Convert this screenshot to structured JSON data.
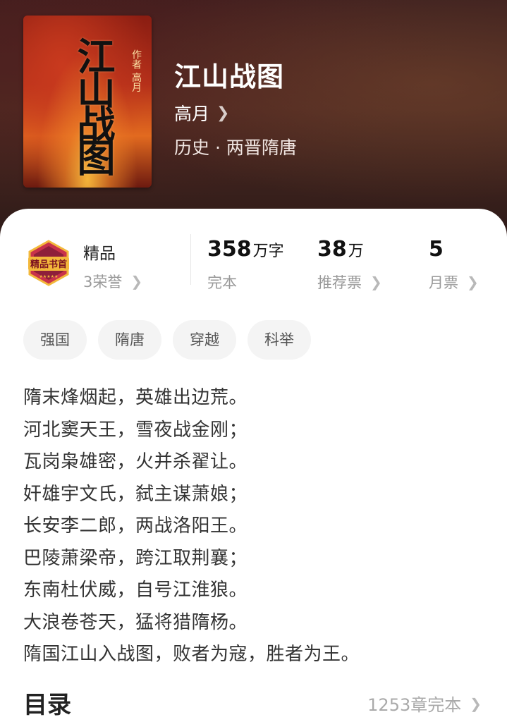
{
  "book": {
    "title": "江山战图",
    "author": "高月",
    "genre": "历史 · 两晋隋唐",
    "cover_title": "江山战图",
    "cover_author": "作者 高月"
  },
  "honor": {
    "badge_text": "精品书首",
    "name": "精品",
    "count": "3荣誉"
  },
  "stats": [
    {
      "value": "358",
      "unit": "万字",
      "label": "完本"
    },
    {
      "value": "38",
      "unit": "万",
      "label": "推荐票"
    },
    {
      "value": "5",
      "unit": "",
      "label": "月票"
    }
  ],
  "tags": [
    "强国",
    "隋唐",
    "穿越",
    "科举"
  ],
  "synopsis": [
    "隋末烽烟起，英雄出边荒。",
    "河北窦天王，雪夜战金刚；",
    "瓦岗枭雄密，火并杀翟让。",
    "奸雄宇文氏，弑主谋萧娘；",
    "长安李二郎，两战洛阳王。",
    "巴陵萧梁帝，跨江取荆襄；",
    "东南杜伏威，自号江淮狼。",
    "大浪卷苍天，猛将猎隋杨。",
    "隋国江山入战图，败者为寇，胜者为王。"
  ],
  "toc": {
    "title": "目录",
    "info": "1253章完本"
  },
  "colors": {
    "header_bg": "#3a1f1f",
    "badge_gold": "#f3b83b",
    "badge_red": "#c8324a"
  }
}
